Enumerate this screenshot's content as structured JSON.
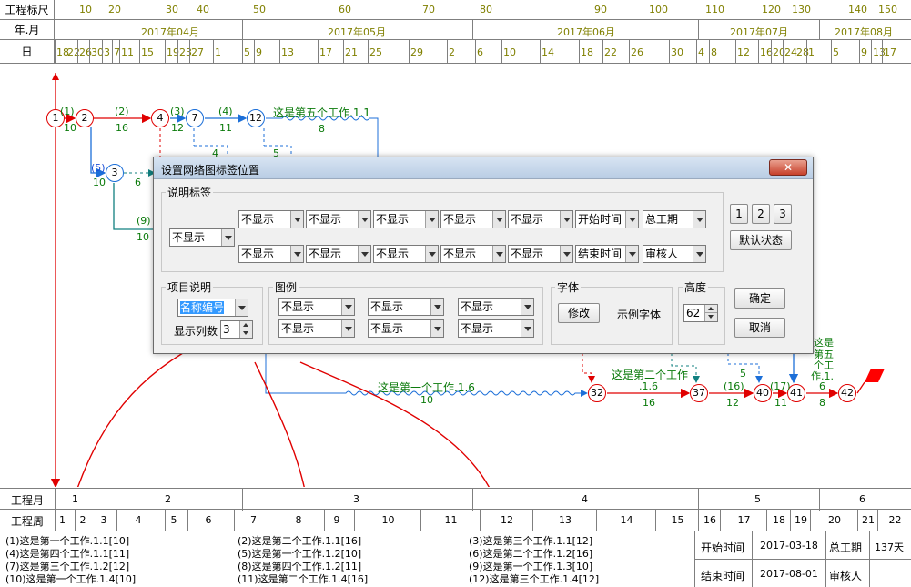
{
  "scale": {
    "label": "工程标尺",
    "ticks": [
      "10",
      "20",
      "30",
      "40",
      "50",
      "60",
      "70",
      "80",
      "90",
      "100",
      "110",
      "120",
      "130",
      "140",
      "150"
    ]
  },
  "month_row": {
    "label": "年.月",
    "months": [
      "2017年04月",
      "2017年05月",
      "2017年06月",
      "2017年07月",
      "2017年08月"
    ]
  },
  "day_row": {
    "label": "日",
    "days": [
      "18",
      "22",
      "26",
      "30",
      "3",
      "7",
      "11",
      "15",
      "19",
      "23",
      "27",
      "1",
      "5",
      "9",
      "13",
      "17",
      "21",
      "25",
      "29",
      "2",
      "6",
      "10",
      "14",
      "18",
      "22",
      "26",
      "30",
      "4",
      "8",
      "12",
      "16",
      "20",
      "24",
      "28",
      "1",
      "5",
      "9",
      "13",
      "17"
    ]
  },
  "network": {
    "nodes": [
      "1",
      "2",
      "4",
      "7",
      "12",
      "3",
      "32",
      "37",
      "40",
      "41",
      "42"
    ],
    "labels": {
      "a1": "(1)",
      "d1": "10",
      "a2": "(2)",
      "d2": "16",
      "a3": "(3)",
      "d3": "12",
      "a4": "(4)",
      "d4": "11",
      "t5": "这是第五个工作.1.1",
      "d5": "8",
      "a5": "(5)",
      "d5b": "10",
      "d6": "6",
      "a9": "(9)",
      "d9": "10",
      "d4b": "4",
      "d5c": "5",
      "t16": "这是第一个工作.1.6",
      "d16": "10",
      "t2_16": "这是第二个工作",
      "t2_16b": ".1.6",
      "d2_16": "16",
      "a16": "(16)",
      "d16b": "12",
      "a17": "(17)",
      "d17": "11",
      "d5d": "5",
      "d6b": "6",
      "d8b": "8",
      "vert": [
        "这是",
        "第五",
        "个工",
        "作.1."
      ]
    }
  },
  "dialog": {
    "title": "设置网络图标签位置",
    "close": "✕",
    "group_labels": {
      "title": "说明标签",
      "left_combo": "不显示",
      "row1": [
        "不显示",
        "不显示",
        "不显示",
        "不显示",
        "不显示",
        "开始时间",
        "总工期"
      ],
      "row2": [
        "不显示",
        "不显示",
        "不显示",
        "不显示",
        "不显示",
        "结束时间",
        "审核人"
      ]
    },
    "preset_buttons": [
      "1",
      "2",
      "3"
    ],
    "default_button": "默认状态",
    "item_group": {
      "title": "项目说明",
      "combo": "名称编号",
      "cols_label": "显示列数",
      "cols_value": "3"
    },
    "legend_group": {
      "title": "图例",
      "combos": [
        "不显示",
        "不显示",
        "不显示",
        "不显示",
        "不显示",
        "不显示"
      ]
    },
    "font_group": {
      "title": "字体",
      "modify": "修改",
      "sample": "示例字体"
    },
    "height_group": {
      "title": "高度",
      "value": "62"
    },
    "ok": "确定",
    "cancel": "取消"
  },
  "bottom": {
    "month_label": "工程月",
    "months": [
      "1",
      "2",
      "3",
      "4",
      "5",
      "6"
    ],
    "week_label": "工程周",
    "weeks": [
      "1",
      "2",
      "3",
      "4",
      "5",
      "6",
      "7",
      "8",
      "9",
      "10",
      "11",
      "12",
      "13",
      "14",
      "15",
      "16",
      "17",
      "18",
      "19",
      "20",
      "21",
      "22"
    ]
  },
  "legend_items": [
    "(1)这是第一个工作.1.1[10]",
    "(2)这是第二个工作.1.1[16]",
    "(3)这是第三个工作.1.1[12]",
    "(4)这是第四个工作.1.1[11]",
    "(5)这是第一个工作.1.2[10]",
    "(6)这是第二个工作.1.2[16]",
    "(7)这是第三个工作.1.2[12]",
    "(8)这是第四个工作.1.2[11]",
    "(9)这是第一个工作.1.3[10]",
    "(10)这是第一个工作.1.4[10]",
    "(11)这是第二个工作.1.4[16]",
    "(12)这是第三个工作.1.4[12]"
  ],
  "info": {
    "start_label": "开始时间",
    "start_value": "2017-03-18",
    "total_label": "总工期",
    "total_value": "137天",
    "end_label": "结束时间",
    "end_value": "2017-08-01",
    "review_label": "审核人"
  },
  "colors": {
    "red": "#e00000",
    "blue": "#1c6fd8",
    "green": "#0a7a0a",
    "olive": "#808000",
    "annotation": "#e00000"
  }
}
